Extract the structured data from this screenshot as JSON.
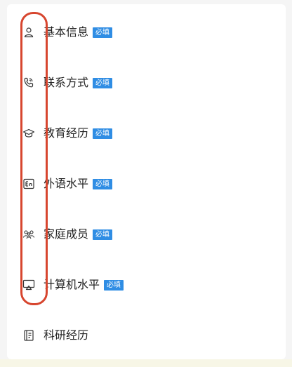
{
  "items": [
    {
      "label": "基本信息",
      "badge": "必填",
      "icon": "person-icon"
    },
    {
      "label": "联系方式",
      "badge": "必填",
      "icon": "phone-icon"
    },
    {
      "label": "教育经历",
      "badge": "必填",
      "icon": "graduation-cap-icon"
    },
    {
      "label": "外语水平",
      "badge": "必填",
      "icon": "en-language-icon"
    },
    {
      "label": "家庭成员",
      "badge": "必填",
      "icon": "family-icon"
    },
    {
      "label": "计算机水平",
      "badge": "必填",
      "icon": "computer-icon"
    },
    {
      "label": "科研经历",
      "icon": "research-icon"
    }
  ],
  "colors": {
    "badge": "#2f8de4",
    "highlight": "#d7462f",
    "text": "#222222",
    "icon": "#333333"
  }
}
